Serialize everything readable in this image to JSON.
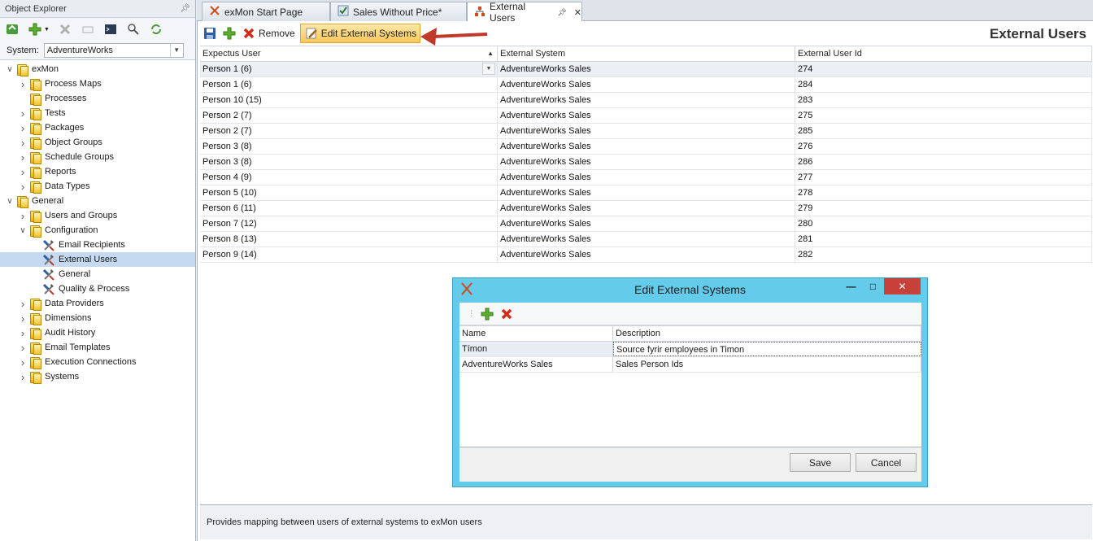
{
  "explorer": {
    "title": "Object Explorer",
    "system_label": "System:",
    "system_value": "AdventureWorks",
    "tree": [
      {
        "label": "exMon",
        "level": 0,
        "expanded": true,
        "icon": "folder"
      },
      {
        "label": "Process Maps",
        "level": 1,
        "expanded": false,
        "icon": "folder"
      },
      {
        "label": "Processes",
        "level": 1,
        "leaf": true,
        "icon": "folder"
      },
      {
        "label": "Tests",
        "level": 1,
        "expanded": false,
        "icon": "folder"
      },
      {
        "label": "Packages",
        "level": 1,
        "expanded": false,
        "icon": "folder"
      },
      {
        "label": "Object Groups",
        "level": 1,
        "expanded": false,
        "icon": "folder"
      },
      {
        "label": "Schedule Groups",
        "level": 1,
        "expanded": false,
        "icon": "folder"
      },
      {
        "label": "Reports",
        "level": 1,
        "expanded": false,
        "icon": "folder"
      },
      {
        "label": "Data Types",
        "level": 1,
        "expanded": false,
        "icon": "folder"
      },
      {
        "label": "General",
        "level": 0,
        "expanded": true,
        "icon": "folder"
      },
      {
        "label": "Users and Groups",
        "level": 1,
        "expanded": false,
        "icon": "folder"
      },
      {
        "label": "Configuration",
        "level": 1,
        "expanded": true,
        "icon": "folder"
      },
      {
        "label": "Email Recipients",
        "level": 2,
        "leaf": true,
        "icon": "tool"
      },
      {
        "label": "External Users",
        "level": 2,
        "leaf": true,
        "icon": "tool",
        "selected": true
      },
      {
        "label": "General",
        "level": 2,
        "leaf": true,
        "icon": "tool"
      },
      {
        "label": "Quality & Process",
        "level": 2,
        "leaf": true,
        "icon": "tool"
      },
      {
        "label": "Data Providers",
        "level": 1,
        "expanded": false,
        "icon": "folder"
      },
      {
        "label": "Dimensions",
        "level": 1,
        "expanded": false,
        "icon": "folder"
      },
      {
        "label": "Audit History",
        "level": 1,
        "expanded": false,
        "icon": "folder"
      },
      {
        "label": "Email Templates",
        "level": 1,
        "expanded": false,
        "icon": "folder"
      },
      {
        "label": "Execution Connections",
        "level": 1,
        "expanded": false,
        "icon": "folder"
      },
      {
        "label": "Systems",
        "level": 1,
        "expanded": false,
        "icon": "folder"
      }
    ]
  },
  "tabs": [
    {
      "label": "exMon Start Page",
      "icon": "exmon-logo-icon"
    },
    {
      "label": "Sales Without Price*",
      "icon": "checklist-icon"
    },
    {
      "label": "External Users",
      "icon": "hierarchy-icon",
      "active": true
    }
  ],
  "toolbar": {
    "remove_label": "Remove",
    "edit_label": "Edit External Systems"
  },
  "doc_title": "External Users",
  "grid": {
    "columns": [
      "Expectus User",
      "External System",
      "External User Id"
    ],
    "rows": [
      [
        "Person 1 (6)",
        "AdventureWorks Sales",
        "274"
      ],
      [
        "Person 1 (6)",
        "AdventureWorks Sales",
        "284"
      ],
      [
        "Person 10 (15)",
        "AdventureWorks Sales",
        "283"
      ],
      [
        "Person 2 (7)",
        "AdventureWorks Sales",
        "275"
      ],
      [
        "Person 2 (7)",
        "AdventureWorks Sales",
        "285"
      ],
      [
        "Person 3 (8)",
        "AdventureWorks Sales",
        "276"
      ],
      [
        "Person 3 (8)",
        "AdventureWorks Sales",
        "286"
      ],
      [
        "Person 4 (9)",
        "AdventureWorks Sales",
        "277"
      ],
      [
        "Person 5 (10)",
        "AdventureWorks Sales",
        "278"
      ],
      [
        "Person 6 (11)",
        "AdventureWorks Sales",
        "279"
      ],
      [
        "Person 7 (12)",
        "AdventureWorks Sales",
        "280"
      ],
      [
        "Person 8 (13)",
        "AdventureWorks Sales",
        "281"
      ],
      [
        "Person 9 (14)",
        "AdventureWorks Sales",
        "282"
      ]
    ]
  },
  "description": "Provides mapping between users of external systems to exMon users",
  "dialog": {
    "title": "Edit External Systems",
    "columns": [
      "Name",
      "Description"
    ],
    "rows": [
      [
        "Tímon",
        "Source fyrir employees in Timon"
      ],
      [
        "AdventureWorks Sales",
        "Sales Person Ids"
      ]
    ],
    "save_label": "Save",
    "cancel_label": "Cancel"
  },
  "colors": {
    "dialog_frame": "#65cbea",
    "highlight_button": "#f9c85a",
    "annotation_arrow": "#c0392b",
    "selection": "#c5daf0"
  }
}
